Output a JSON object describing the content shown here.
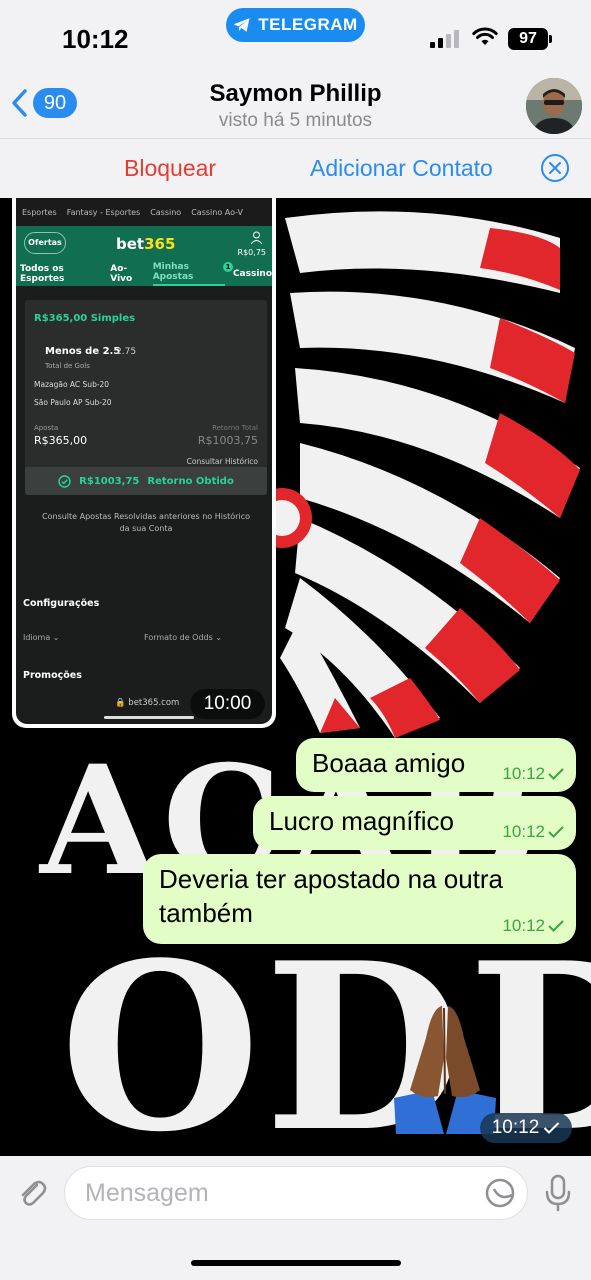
{
  "status_bar": {
    "time": "10:12",
    "pill_label": "TELEGRAM",
    "battery": "97"
  },
  "header": {
    "back_count": "90",
    "contact_name": "Saymon Phillip",
    "last_seen": "visto há 5 minutos"
  },
  "actions": {
    "block_label": "Bloquear",
    "add_contact_label": "Adicionar Contato"
  },
  "screenshot": {
    "top_nav": [
      "Esportes",
      "Fantasy - Esportes",
      "Cassino",
      "Cassino Ao-V"
    ],
    "offers_label": "Ofertas",
    "logo_main": "bet",
    "logo_accent": "365",
    "balance": "R$0,75",
    "tabs": [
      "Todos os Esportes",
      "Ao-Vivo",
      "Minhas Apostas",
      "Cassino"
    ],
    "tab_badge": "1",
    "bet_title": "R$365,00 Simples",
    "selection": "Menos de 2.5",
    "odds": "2.75",
    "market": "Total de Gols",
    "team_home": "Mazagão AC Sub-20",
    "team_away": "São Paulo AP Sub-20",
    "stake_label": "Aposta",
    "stake_value": "R$365,00",
    "return_label": "Retorno Total",
    "return_value": "R$1003,75",
    "history_link": "Consultar Histórico",
    "result_amount": "R$1003,75",
    "result_label": "Retorno Obtido",
    "consult_text": "Consulte Apostas Resolvidas anteriores no Histórico da sua Conta",
    "settings_heading": "Configurações",
    "language_label": "Idioma",
    "odds_format_label": "Formato de Odds",
    "promotions_heading": "Promoções",
    "url": "bet365.com",
    "timestamp": "10:00"
  },
  "messages": [
    {
      "text": "Boaaa amigo",
      "time": "10:12"
    },
    {
      "text": "Lucro magnífico",
      "time": "10:12"
    },
    {
      "text": "Deveria ter apostado na outra também",
      "time": "10:12"
    }
  ],
  "emoji_message": {
    "emoji": "🙏🏾",
    "time": "10:12"
  },
  "input": {
    "placeholder": "Mensagem"
  },
  "colors": {
    "accent_blue": "#2b8cf0",
    "danger_red": "#e63c34",
    "bubble_green": "#e2fec6",
    "bet365_green": "#126e51"
  },
  "icons": [
    "telegram-icon",
    "signal-icon",
    "wifi-icon",
    "chevron-left-icon",
    "close-icon",
    "attach-icon",
    "sticker-icon",
    "mic-icon",
    "check-icon"
  ]
}
